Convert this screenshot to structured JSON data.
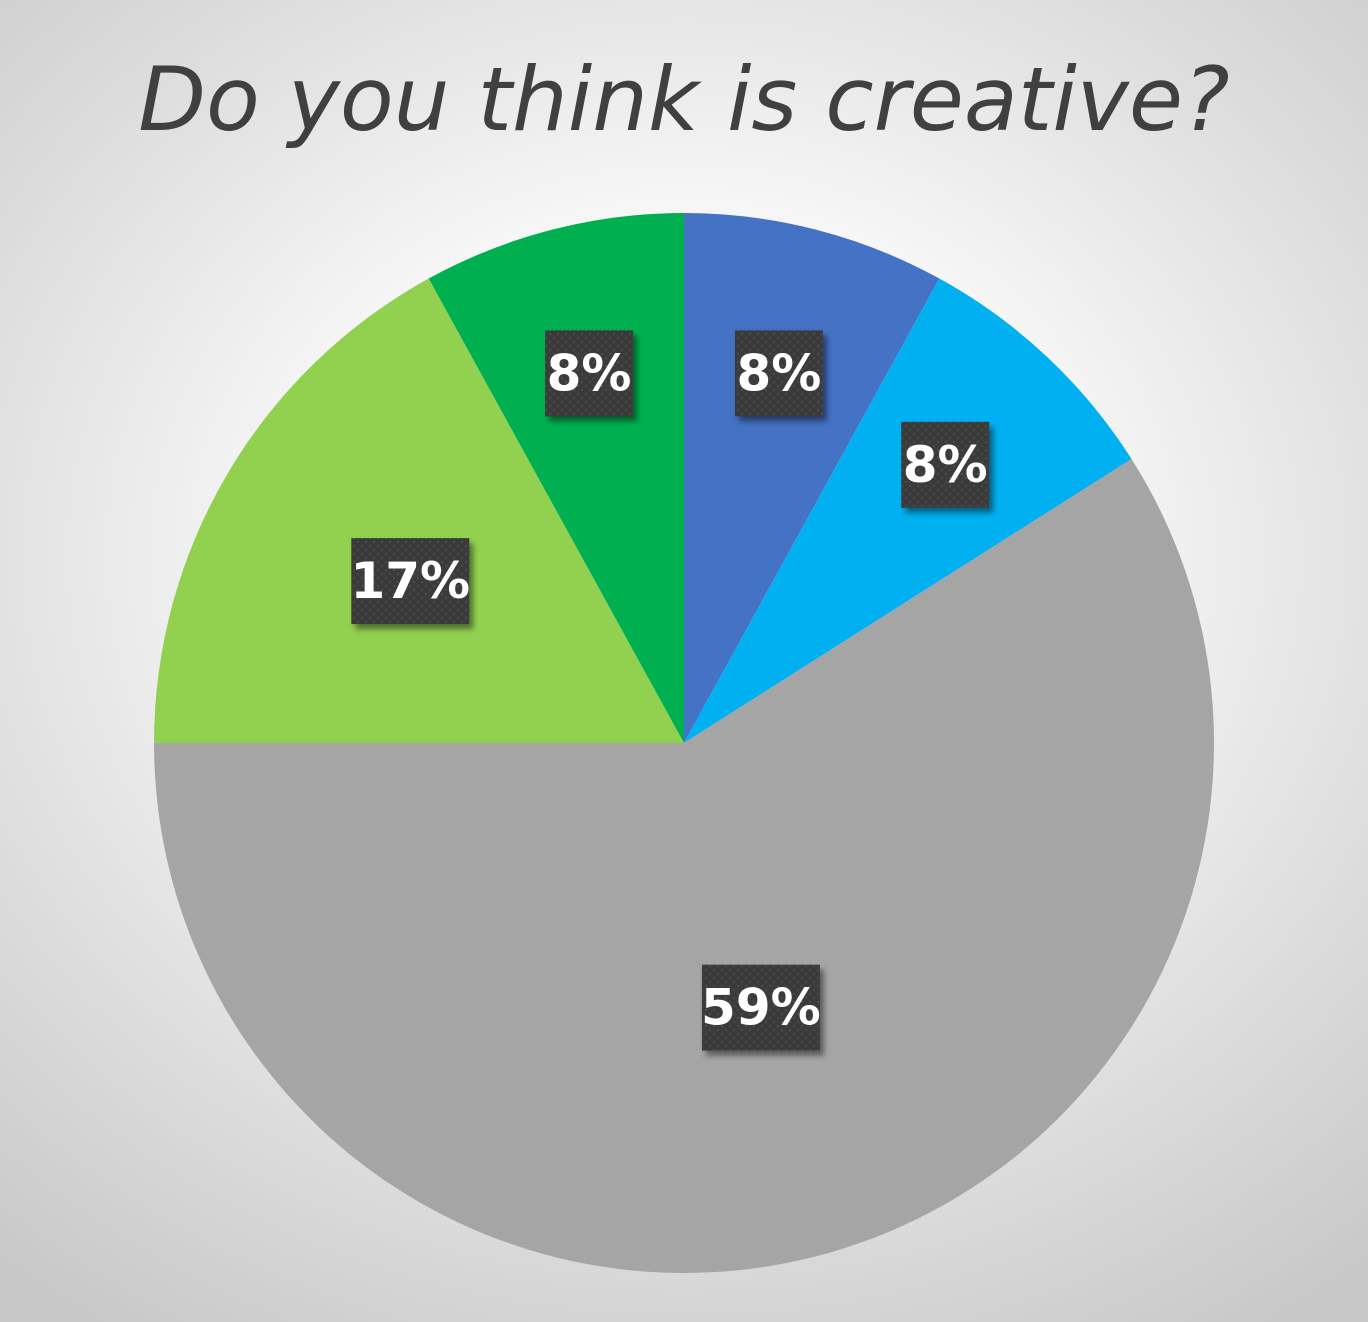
{
  "chart_data": {
    "type": "pie",
    "title": "Do you think is creative?",
    "slices": [
      {
        "value": 8,
        "label": "8%",
        "color": "#4472C4"
      },
      {
        "value": 8,
        "label": "8%",
        "color": "#00B0F0"
      },
      {
        "value": 59,
        "label": "59%",
        "color": "#A5A5A5"
      },
      {
        "value": 17,
        "label": "17%",
        "color": "#92D050"
      },
      {
        "value": 8,
        "label": "8%",
        "color": "#00B050"
      }
    ],
    "start_angle_deg": 0,
    "direction": "clockwise",
    "legend": "none",
    "data_labels": "percent"
  }
}
